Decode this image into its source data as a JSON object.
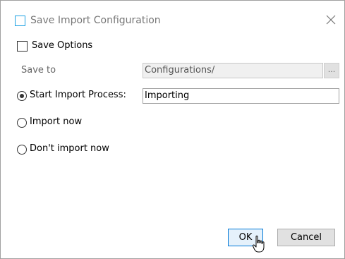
{
  "window": {
    "title": "Save Import Configuration",
    "title_icon": "square-icon",
    "close_icon": "close-icon"
  },
  "save_options": {
    "label": "Save Options",
    "checked": false
  },
  "save_to": {
    "label": "Save to",
    "value": "Configurations/",
    "browse_label": "..."
  },
  "radio_options": [
    {
      "label": "Start Import Process:",
      "selected": true
    },
    {
      "label": "Import now",
      "selected": false
    },
    {
      "label": "Don't import now",
      "selected": false
    }
  ],
  "process_name": {
    "value": "Importing"
  },
  "buttons": {
    "ok_label": "OK",
    "cancel_label": "Cancel"
  },
  "colors": {
    "accent": "#0078d7",
    "title_icon": "#1ba1e2"
  }
}
